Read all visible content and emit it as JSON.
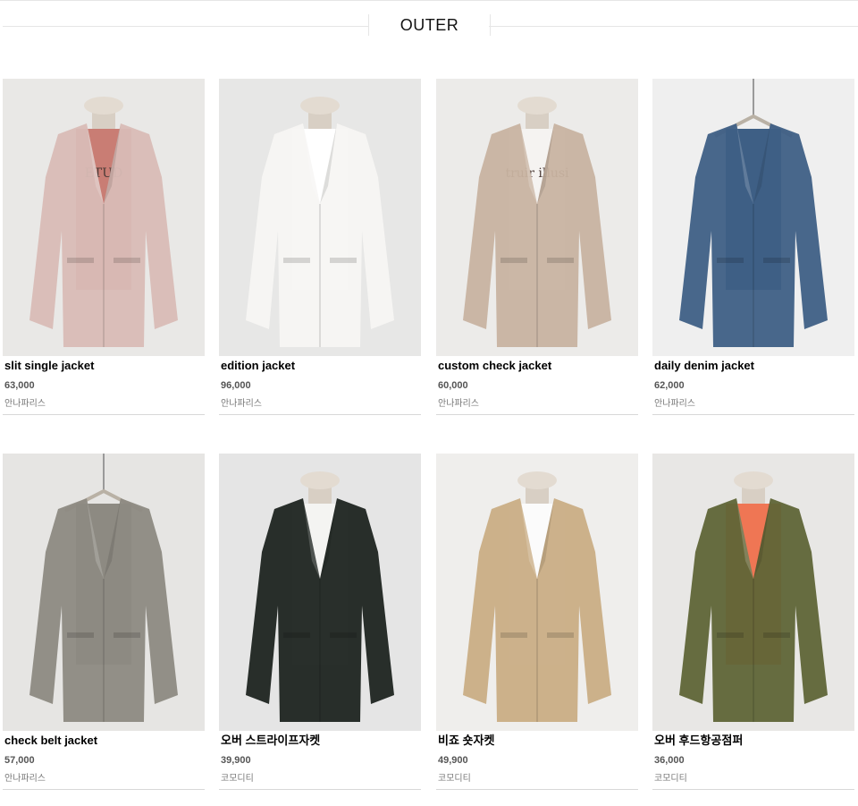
{
  "section": {
    "title": "OUTER"
  },
  "products": [
    {
      "name": "slit single jacket",
      "price": "63,000",
      "brand": "안나파리스",
      "bg": "#e9e8e6",
      "garment": "#d9bcb6",
      "inner": "#c97d74",
      "tee_text": "ETUD",
      "hanger": false
    },
    {
      "name": "edition jacket",
      "price": "96,000",
      "brand": "안나파리스",
      "bg": "#e7e7e6",
      "garment": "#f7f6f3",
      "inner": "#ffffff",
      "tee_text": "",
      "hanger": false
    },
    {
      "name": "custom check jacket",
      "price": "60,000",
      "brand": "안나파리스",
      "bg": "#ecebe9",
      "garment": "#c8b3a1",
      "inner": "#f5f3f1",
      "tee_text": "truir illusi",
      "hanger": false
    },
    {
      "name": "daily denim jacket",
      "price": "62,000",
      "brand": "안나파리스",
      "bg": "#efefef",
      "garment": "#3e5f85",
      "inner": "#3e5f85",
      "tee_text": "",
      "hanger": true
    },
    {
      "name": "check belt jacket",
      "price": "57,000",
      "brand": "안나파리스",
      "bg": "#e6e5e3",
      "garment": "#8d8a82",
      "inner": "#8d8a82",
      "tee_text": "",
      "hanger": true
    },
    {
      "name": "오버 스트라이프자켓",
      "price": "39,900",
      "brand": "코모디티",
      "bg": "#e5e5e5",
      "garment": "#1e2420",
      "inner": "#f4f4f2",
      "tee_text": "",
      "hanger": false
    },
    {
      "name": "비죠 숏자켓",
      "price": "49,900",
      "brand": "코모디티",
      "bg": "#efeeec",
      "garment": "#c9ad85",
      "inner": "#fbfbfb",
      "tee_text": "",
      "hanger": false
    },
    {
      "name": "오버 후드항공점퍼",
      "price": "36,000",
      "brand": "코모디티",
      "bg": "#e8e7e5",
      "garment": "#5f6537",
      "inner": "#ef7654",
      "tee_text": "",
      "hanger": false
    }
  ]
}
